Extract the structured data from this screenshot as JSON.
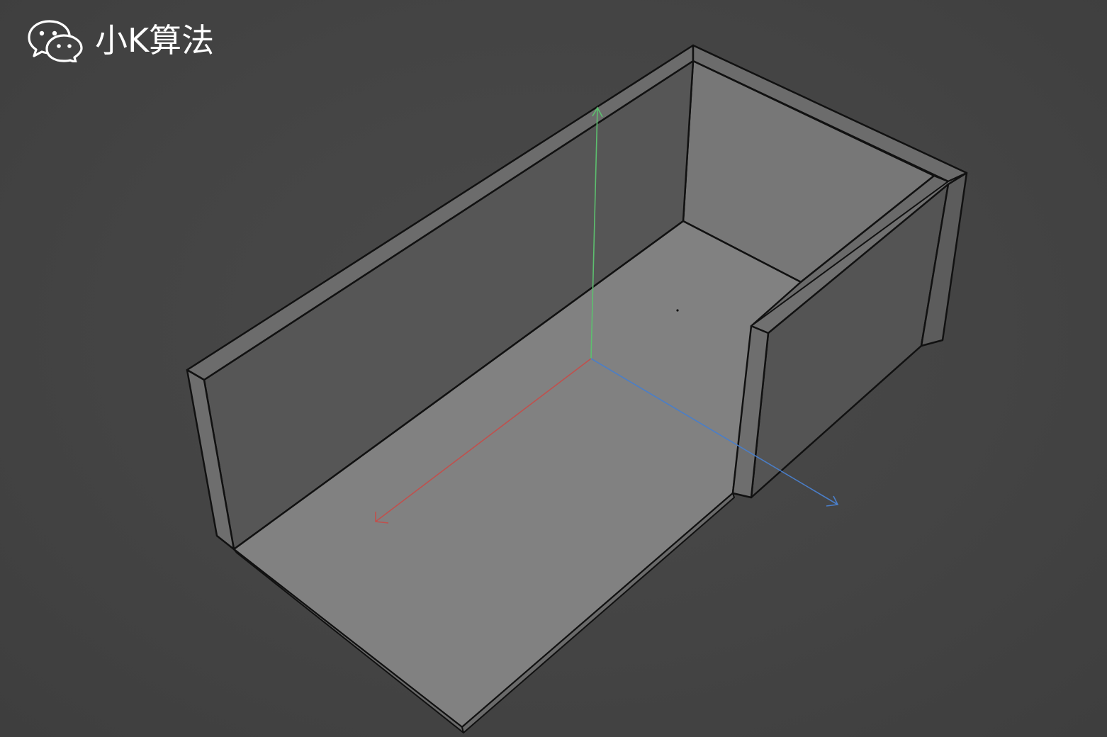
{
  "watermark": {
    "text": "小K算法",
    "icon": "wechat-icon"
  },
  "viewport": {
    "background_color": "#444444",
    "axes": [
      {
        "name": "x-axis",
        "color": "#c0504d"
      },
      {
        "name": "y-axis",
        "color": "#5dbf6f"
      },
      {
        "name": "z-axis",
        "color": "#4a7ec8"
      }
    ]
  }
}
